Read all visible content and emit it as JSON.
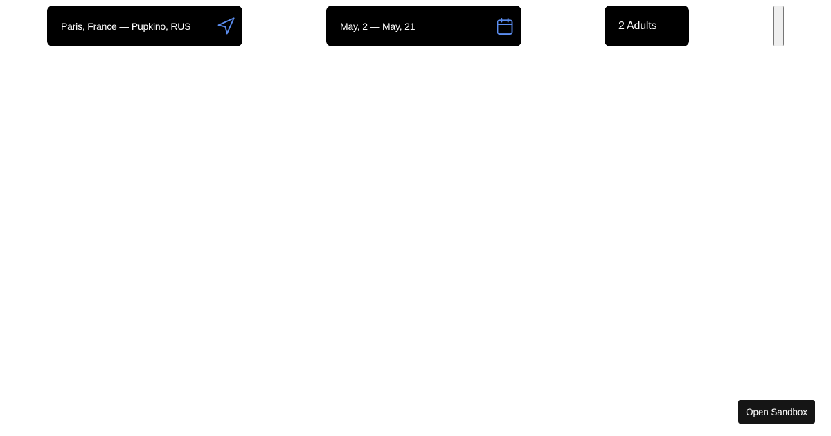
{
  "search_bar": {
    "route": {
      "value": "Paris, France — Pupkino, RUS",
      "icon": "navigation-arrow-icon"
    },
    "dates": {
      "value": "May, 2 — May, 21",
      "icon": "calendar-icon"
    },
    "guests": {
      "value": "2 Adults"
    },
    "submit": {
      "label": ""
    }
  },
  "footer": {
    "sandbox_label": "Open Sandbox"
  },
  "colors": {
    "field_background": "#000000",
    "field_text": "#ffffff",
    "icon_accent": "#5b8def",
    "sandbox_background": "#151515"
  }
}
